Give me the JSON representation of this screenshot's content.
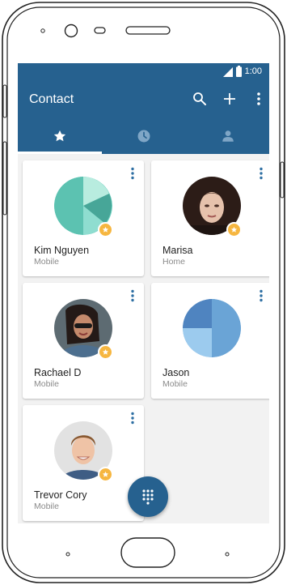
{
  "status": {
    "time": "1:00"
  },
  "appbar": {
    "title": "Contact"
  },
  "tabs": [
    {
      "icon": "star-icon",
      "selected": true
    },
    {
      "icon": "clock-icon",
      "selected": false
    },
    {
      "icon": "person-icon",
      "selected": false
    }
  ],
  "contacts": [
    {
      "name": "Kim Nguyen",
      "type": "Mobile",
      "favorite": true,
      "avatar": "pie-chart-avatar-teal"
    },
    {
      "name": "Marisa",
      "type": "Home",
      "favorite": true,
      "avatar": "photo-avatar"
    },
    {
      "name": "Rachael D",
      "type": "Mobile",
      "favorite": true,
      "avatar": "photo-avatar"
    },
    {
      "name": "Jason",
      "type": "Mobile",
      "favorite": false,
      "avatar": "pie-chart-avatar-blue"
    },
    {
      "name": "Trevor Cory",
      "type": "Mobile",
      "favorite": true,
      "avatar": "photo-avatar"
    }
  ],
  "colors": {
    "primary": "#26618f",
    "accent": "#f6b640",
    "background": "#f2f2f2"
  },
  "fab": {
    "icon": "dialpad-icon"
  }
}
